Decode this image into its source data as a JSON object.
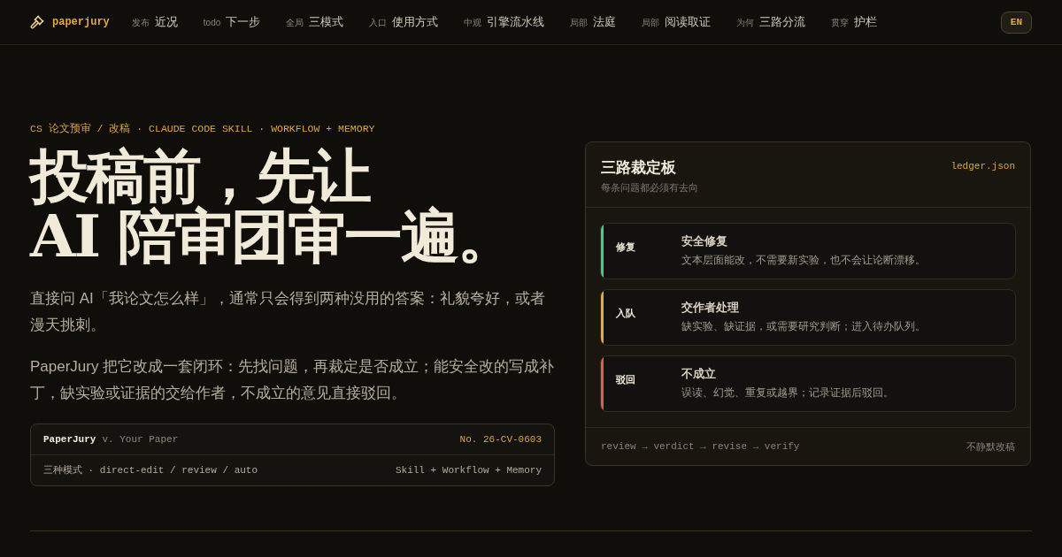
{
  "nav": {
    "brand": "paperjury",
    "items": [
      {
        "prefix": "发布",
        "label": "近况"
      },
      {
        "prefix": "todo",
        "label": "下一步"
      },
      {
        "prefix": "全局",
        "label": "三模式"
      },
      {
        "prefix": "入口",
        "label": "使用方式"
      },
      {
        "prefix": "中观",
        "label": "引擎流水线"
      },
      {
        "prefix": "局部",
        "label": "法庭"
      },
      {
        "prefix": "局部",
        "label": "阅读取证"
      },
      {
        "prefix": "为何",
        "label": "三路分流"
      },
      {
        "prefix": "贯穿",
        "label": "护栏"
      }
    ],
    "lang_button": "EN"
  },
  "hero": {
    "eyebrow": "CS 论文预审 / 改稿 · CLAUDE CODE SKILL · WORKFLOW + MEMORY",
    "title_lines": [
      "投稿前，先让",
      "AI 陪审团审一遍。"
    ],
    "paragraphs": [
      "直接问 AI「我论文怎么样」，通常只会得到两种没用的答案：礼貌夸好，或者漫天挑刺。",
      "PaperJury 把它改成一套闭环：先找问题，再裁定是否成立；能安全改的写成补丁，缺实验或证据的交给作者，不成立的意见直接驳回。"
    ],
    "case_card": {
      "plaintiff": "PaperJury",
      "versus": "v. Your Paper",
      "docket": "No. 26-CV-0603",
      "modes": "三种模式 · direct-edit / review / auto",
      "stack": "Skill + Workflow + Memory"
    }
  },
  "ledger": {
    "title": "三路裁定板",
    "subtitle": "每条问题都必须有去向",
    "file": "ledger.json",
    "lanes": [
      {
        "tag": "修复",
        "title": "安全修复",
        "description": "文本层面能改，不需要新实验，也不会让论断漂移。",
        "color": "#3ecf8e"
      },
      {
        "tag": "入队",
        "title": "交作者处理",
        "description": "缺实验、缺证据，或需要研究判断；进入待办队列。",
        "color": "#e8a838"
      },
      {
        "tag": "驳回",
        "title": "不成立",
        "description": "误读、幻觉、重复或越界；记录证据后驳回。",
        "color": "#e05a5a"
      }
    ],
    "footer_flow": "review → verdict → revise → verify",
    "footer_note": "不静默改稿"
  }
}
